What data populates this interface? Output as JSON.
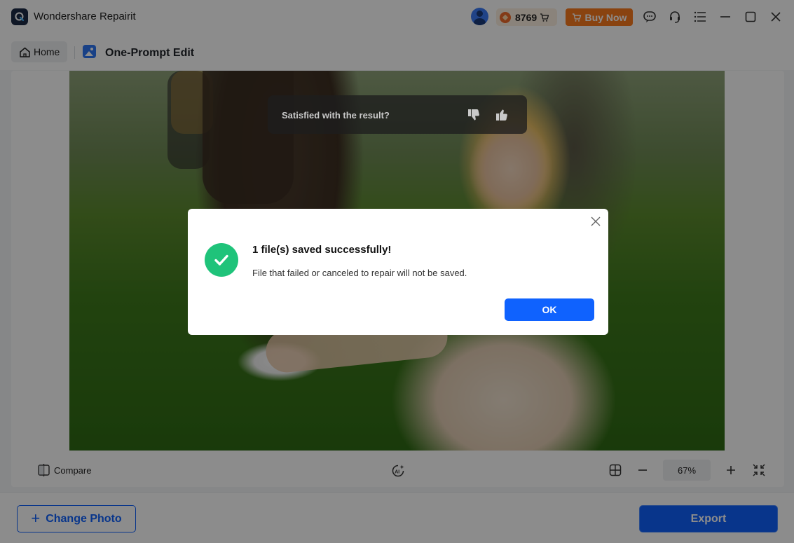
{
  "titlebar": {
    "app_title": "Wondershare Repairit",
    "credits": "8769",
    "buy_now": "Buy Now"
  },
  "nav": {
    "home_label": "Home",
    "mode_title": "One-Prompt Edit"
  },
  "feedback": {
    "question": "Satisfied with the result?"
  },
  "dialog": {
    "title": "1 file(s) saved successfully!",
    "message": "File that failed or canceled to repair will not be saved.",
    "ok_label": "OK"
  },
  "toolbar": {
    "compare_label": "Compare",
    "zoom_value": "67%"
  },
  "footer": {
    "change_photo_label": "Change Photo",
    "export_label": "Export"
  },
  "colors": {
    "accent": "#0f62fe",
    "buy_now": "#fa7a1e",
    "success": "#1fc37a"
  },
  "icons": [
    "app-logo-icon",
    "avatar-icon",
    "coin-icon",
    "cart-icon",
    "feedback-icon",
    "headset-icon",
    "menu-icon",
    "minimize-icon",
    "maximize-icon",
    "close-icon",
    "home-icon",
    "image-icon",
    "thumbs-down-icon",
    "thumbs-up-icon",
    "check-icon",
    "compare-icon",
    "ai-icon",
    "grid-icon",
    "minus-icon",
    "plus-icon",
    "fit-screen-icon"
  ]
}
